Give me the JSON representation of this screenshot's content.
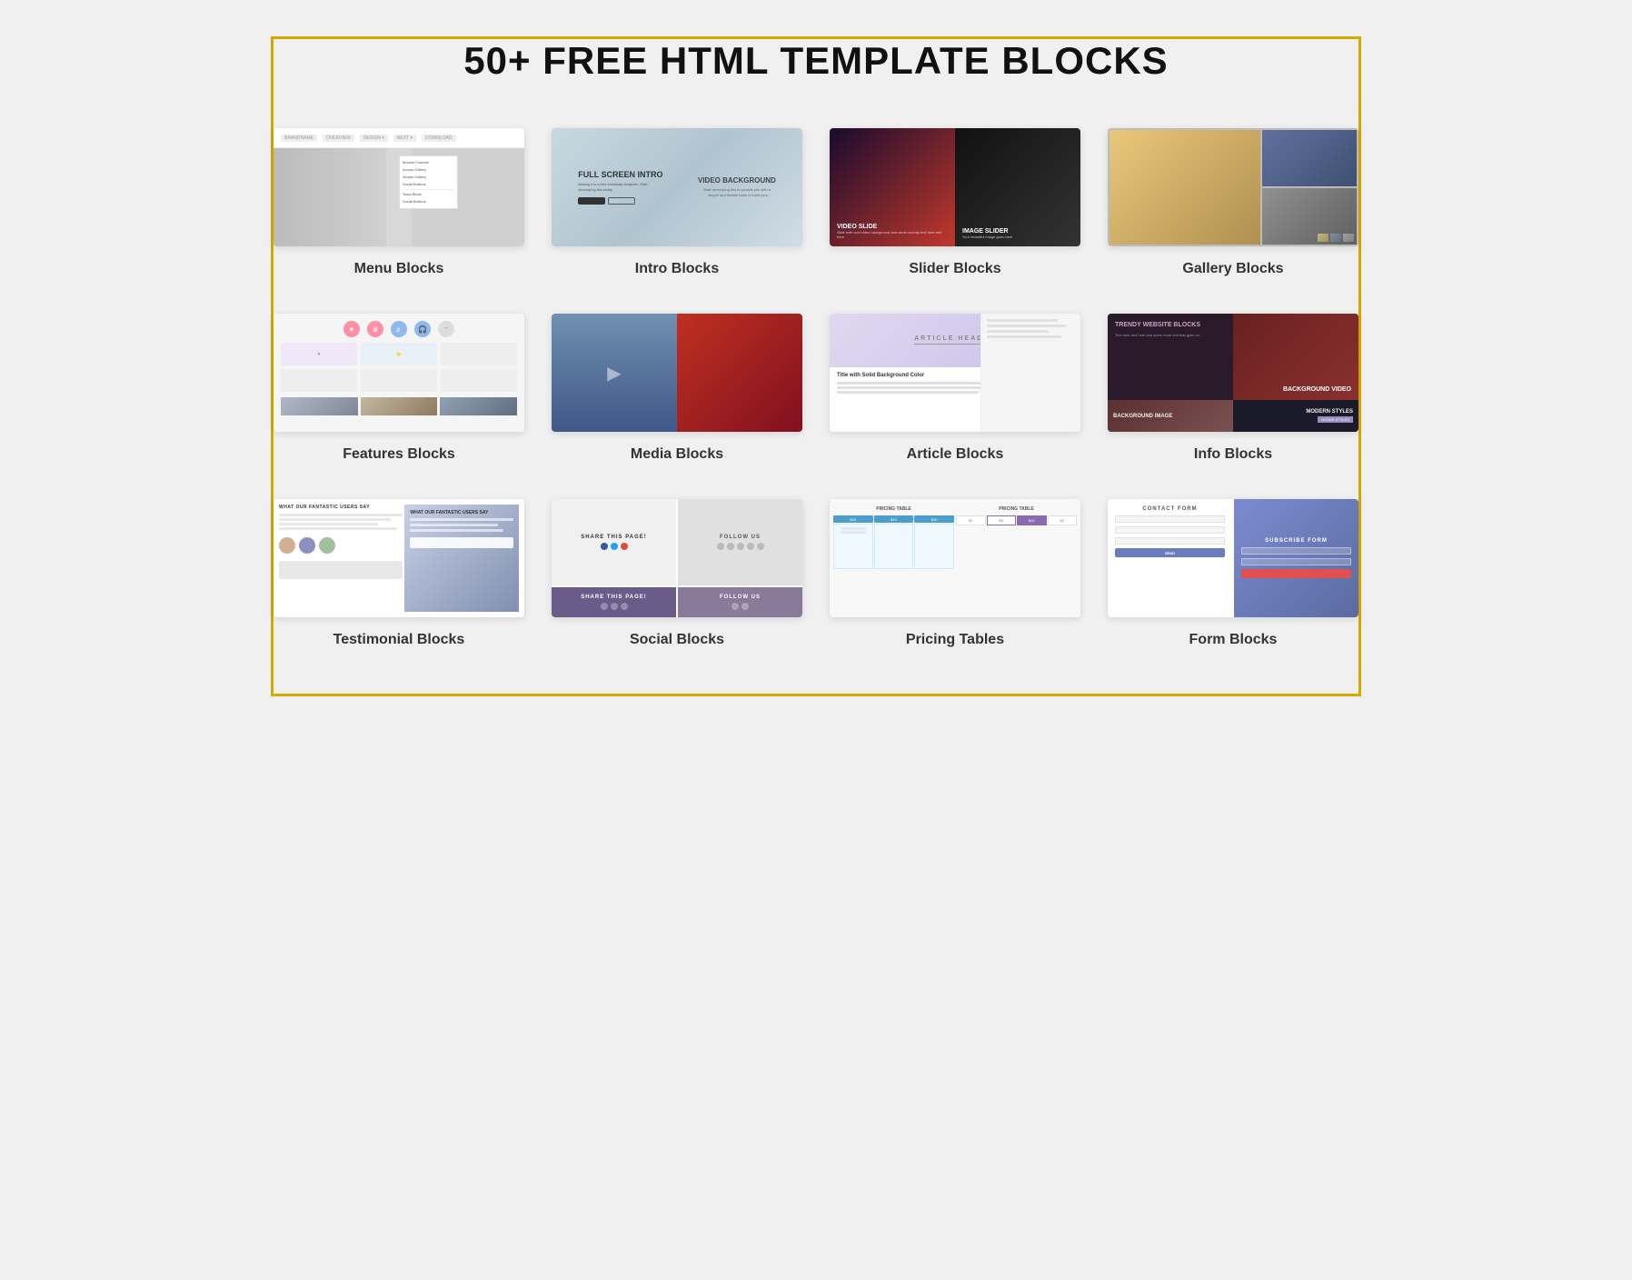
{
  "page": {
    "title": "50+ FREE HTML TEMPLATE BLOCKS",
    "border_color": "#d4aa00"
  },
  "blocks": [
    {
      "id": "menu-blocks",
      "label": "Menu Blocks",
      "preview_type": "menu"
    },
    {
      "id": "intro-blocks",
      "label": "Intro Blocks",
      "preview_type": "intro",
      "text1": "FULL SCREEN INTRO",
      "text2": "VIDEO BACKGROUND"
    },
    {
      "id": "slider-blocks",
      "label": "Slider Blocks",
      "preview_type": "slider",
      "text1": "VIDEO SLIDE",
      "text2": "IMAGE SLIDER"
    },
    {
      "id": "gallery-blocks",
      "label": "Gallery Blocks",
      "preview_type": "gallery"
    },
    {
      "id": "features-blocks",
      "label": "Features Blocks",
      "preview_type": "features"
    },
    {
      "id": "media-blocks",
      "label": "Media Blocks",
      "preview_type": "media"
    },
    {
      "id": "article-blocks",
      "label": "Article Blocks",
      "preview_type": "article",
      "text1": "ARTICLE HEADER",
      "text2": "Title with Solid Background Color"
    },
    {
      "id": "info-blocks",
      "label": "Info Blocks",
      "preview_type": "info",
      "text1": "TRENDY WEBSITE BLOCKS",
      "text2": "BACKGROUND VIDEO",
      "text3": "BACKGROUND IMAGE",
      "text4": "MODERN STYLES"
    },
    {
      "id": "testimonial-blocks",
      "label": "Testimonial Blocks",
      "preview_type": "testimonial",
      "text1": "WHAT OUR FANTASTIC USERS SAY"
    },
    {
      "id": "social-blocks",
      "label": "Social Blocks",
      "preview_type": "social",
      "text1": "SHARE THIS PAGE!",
      "text2": "FOLLOW US",
      "text3": "SHARE THIS PAGE!",
      "text4": "FOLLOW US"
    },
    {
      "id": "pricing-tables",
      "label": "Pricing Tables",
      "preview_type": "pricing",
      "text1": "PRICING TABLE"
    },
    {
      "id": "form-blocks",
      "label": "Form Blocks",
      "preview_type": "form",
      "text1": "CONTACT FORM",
      "text2": "SUBSCRIBE FORM"
    }
  ]
}
